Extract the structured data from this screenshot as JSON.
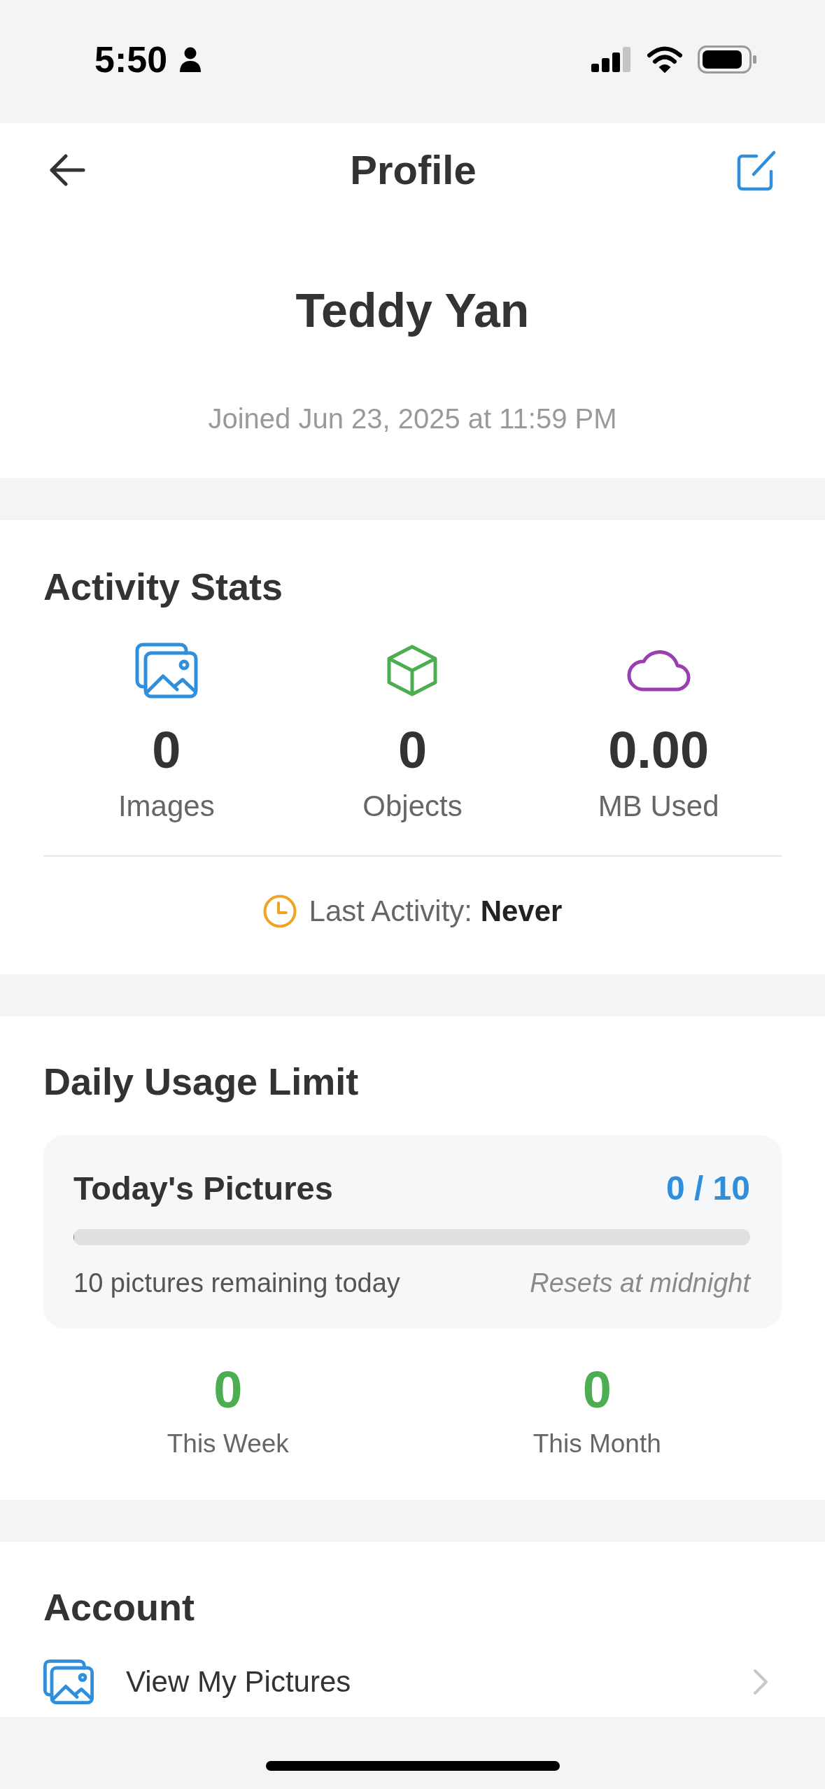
{
  "status_bar": {
    "time": "5:50"
  },
  "header": {
    "title": "Profile"
  },
  "profile": {
    "name": "Teddy Yan",
    "joined": "Joined Jun 23, 2025 at 11:59 PM"
  },
  "activity_stats": {
    "title": "Activity Stats",
    "stats": [
      {
        "kind": "images",
        "value": "0",
        "label": "Images",
        "color": "#2f8fdd"
      },
      {
        "kind": "objects",
        "value": "0",
        "label": "Objects",
        "color": "#4cae50"
      },
      {
        "kind": "storage",
        "value": "0.00",
        "label": "MB Used",
        "color": "#9b3db3"
      }
    ],
    "last_activity": {
      "label": "Last Activity:",
      "value": "Never"
    }
  },
  "daily_usage": {
    "title": "Daily Usage Limit",
    "today": {
      "label": "Today's Pictures",
      "count": "0 / 10",
      "level": 0,
      "remaining": "10 pictures remaining today",
      "reset_note": "Resets at midnight"
    },
    "totals": [
      {
        "value": "0",
        "label": "This Week"
      },
      {
        "value": "0",
        "label": "This Month"
      }
    ]
  },
  "account": {
    "title": "Account",
    "items": [
      {
        "kind": "pictures",
        "label": "View My Pictures"
      }
    ]
  }
}
